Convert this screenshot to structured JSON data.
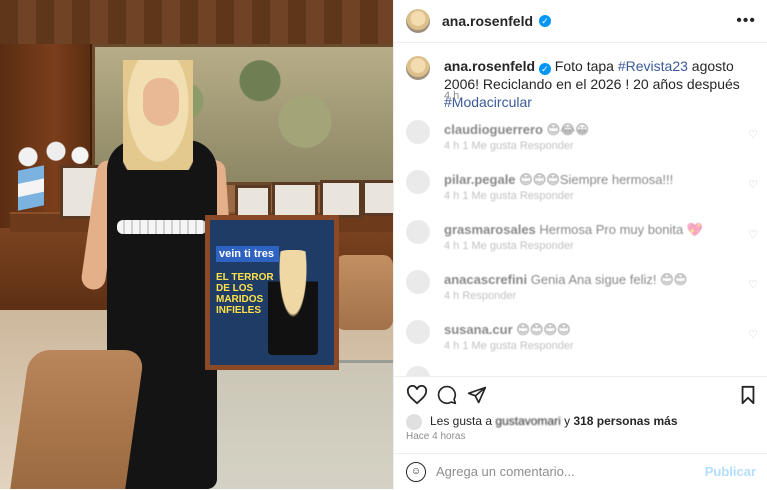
{
  "post": {
    "username": "ana.rosenfeld",
    "caption_user": "ana.rosenfeld",
    "caption_text_1": " Foto tapa ",
    "caption_tag_1": "#Revista23",
    "caption_text_2": " agosto 2006! Reciclando en el 2026 ! 20 años después ",
    "caption_tag_2": "#Modacircular",
    "caption_time": "4 h",
    "more_icon": "more-horizontal-icon"
  },
  "photo": {
    "cover_masthead": "vein ti tres",
    "cover_headline": "EL TERROR DE LOS MARIDOS INFIELES"
  },
  "comments": [
    {
      "user": "claudioguerrero",
      "text": "😊😂😀",
      "meta": "4 h   1 Me gusta   Responder"
    },
    {
      "user": "pilar.pegale",
      "text": "😊😊😊Siempre hermosa!!!",
      "meta": "4 h   1 Me gusta   Responder"
    },
    {
      "user": "grasmarosales",
      "text": "Hermosa Pro muy bonita 💖",
      "meta": "4 h   1 Me gusta   Responder"
    },
    {
      "user": "anacascrefini",
      "text": "Genia Ana sigue feliz! 😊😊",
      "meta": "4 h   Responder"
    },
    {
      "user": "susana.cur",
      "text": "😊😊😊😊",
      "meta": "4 h   1 Me gusta   Responder"
    },
    {
      "user": "",
      "text": "",
      "meta": ""
    }
  ],
  "actions": {
    "like_icon": "heart-icon",
    "comment_icon": "comment-icon",
    "share_icon": "send-icon",
    "save_icon": "bookmark-icon"
  },
  "likes": {
    "prefix": "Les gusta a ",
    "user": "gustavomari",
    "suffix": " y ",
    "count": "318 personas más"
  },
  "ago": "Hace 4 horas",
  "compose": {
    "placeholder": "Agrega un comentario...",
    "post_label": "Publicar",
    "emoji_icon": "emoji-icon"
  },
  "colors": {
    "verified": "#0095f6",
    "hashtag": "#3b5998",
    "post_button": "#b2dffc"
  }
}
